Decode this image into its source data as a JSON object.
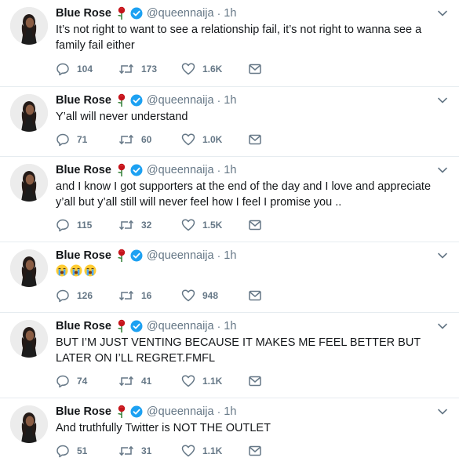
{
  "colors": {
    "name": "#14171a",
    "muted": "#657786",
    "verified": "#1da1f2",
    "divider": "#e6ecf0",
    "rose": "#c4141b"
  },
  "icons": {
    "reply": "reply-icon",
    "retweet": "retweet-icon",
    "like": "heart-icon",
    "dm": "envelope-icon",
    "menu": "chevron-down-icon",
    "verified": "verified-badge-icon",
    "rose": "rose-emoji-icon",
    "crying": "loudly-crying-face-emoji"
  },
  "tweets": [
    {
      "name": "Blue Rose",
      "handle": "@queennaija",
      "separator": "·",
      "time": "1h",
      "text": "It’s not right to want to see a relationship fail, it’s not right to wanna see a family fail either",
      "replies": "104",
      "retweets": "173",
      "likes": "1.6K"
    },
    {
      "name": "Blue Rose",
      "handle": "@queennaija",
      "separator": "·",
      "time": "1h",
      "text": "Y’all will never understand",
      "replies": "71",
      "retweets": "60",
      "likes": "1.0K"
    },
    {
      "name": "Blue Rose",
      "handle": "@queennaija",
      "separator": "·",
      "time": "1h",
      "text": "and I know I got supporters at the end of the day and I love and appreciate y’all but y’all still will never feel how I feel I promise you ..",
      "replies": "115",
      "retweets": "32",
      "likes": "1.5K"
    },
    {
      "name": "Blue Rose",
      "handle": "@queennaija",
      "separator": "·",
      "time": "1h",
      "text": "",
      "emoji_count": 3,
      "replies": "126",
      "retweets": "16",
      "likes": "948"
    },
    {
      "name": "Blue Rose",
      "handle": "@queennaija",
      "separator": "·",
      "time": "1h",
      "text": "BUT I’M JUST VENTING BECAUSE IT MAKES ME FEEL BETTER BUT LATER ON I’LL REGRET.FMFL",
      "replies": "74",
      "retweets": "41",
      "likes": "1.1K"
    },
    {
      "name": "Blue Rose",
      "handle": "@queennaija",
      "separator": "·",
      "time": "1h",
      "text": "And truthfully Twitter is NOT THE OUTLET",
      "replies": "51",
      "retweets": "31",
      "likes": "1.1K"
    }
  ]
}
